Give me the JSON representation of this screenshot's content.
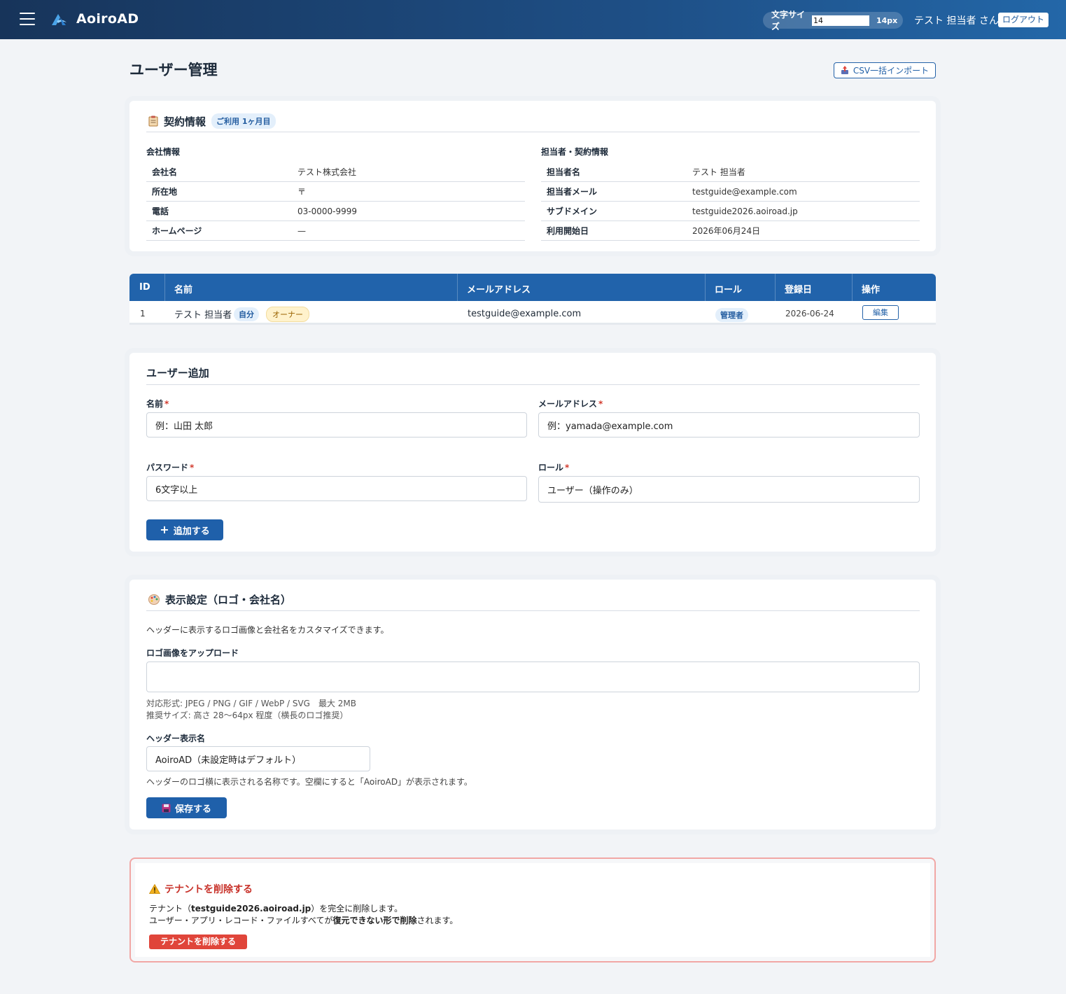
{
  "header": {
    "brand": "AoiroAD",
    "font_size_label": "文字サイズ",
    "font_size_input": "14",
    "font_size_value": "14px",
    "user_name": "テスト 担当者 さん",
    "logout_label": "ログアウト"
  },
  "page": {
    "title": "ユーザー管理",
    "csv_import_label": "CSV一括インポート"
  },
  "contract": {
    "title": "契約情報",
    "usage_badge": "ご利用 1ヶ月目",
    "company_heading": "会社情報",
    "company_rows": [
      {
        "key": "会社名",
        "value": "テスト株式会社"
      },
      {
        "key": "所在地",
        "value": "〒"
      },
      {
        "key": "電話",
        "value": "03-0000-9999"
      },
      {
        "key": "ホームページ",
        "value": "—"
      }
    ],
    "manager_heading": "担当者・契約情報",
    "manager_rows": [
      {
        "key": "担当者名",
        "value": "テスト 担当者"
      },
      {
        "key": "担当者メール",
        "value": "testguide@example.com"
      },
      {
        "key": "サブドメイン",
        "value": "testguide2026.aoiroad.jp"
      },
      {
        "key": "利用開始日",
        "value": "2026年06月24日"
      }
    ]
  },
  "users_table": {
    "columns": [
      "ID",
      "名前",
      "メールアドレス",
      "ロール",
      "登録日",
      "操作"
    ],
    "rows": [
      {
        "id": "1",
        "name": "テスト 担当者",
        "self_badge": "自分",
        "owner_badge": "オーナー",
        "email": "testguide@example.com",
        "role": "管理者",
        "registered": "2026-06-24",
        "action": "編集"
      }
    ]
  },
  "add_user": {
    "title": "ユーザー追加",
    "name_label": "名前",
    "name_placeholder": "例：山田 太郎",
    "email_label": "メールアドレス",
    "email_placeholder": "例：yamada@example.com",
    "password_label": "パスワード",
    "password_placeholder": "6文字以上",
    "role_label": "ロール",
    "role_value": "ユーザー（操作のみ）",
    "required_mark": "*",
    "submit_label": "追加する"
  },
  "display_settings": {
    "title": "表示設定（ロゴ・会社名）",
    "description": "ヘッダーに表示するロゴ画像と会社名をカスタマイズできます。",
    "logo_label": "ロゴ画像をアップロード",
    "formats_note": "対応形式: JPEG / PNG / GIF / WebP / SVG　最大 2MB",
    "size_note": "推奨サイズ: 高さ 28〜64px 程度（横長のロゴ推奨）",
    "header_name_label": "ヘッダー表示名",
    "header_name_placeholder": "AoiroAD（未設定時はデフォルト）",
    "header_name_note": "ヘッダーのロゴ横に表示される名称です。空欄にすると「AoiroAD」が表示されます。",
    "save_label": "保存する"
  },
  "danger": {
    "title": "テナントを削除する",
    "line1_prefix": "テナント（",
    "line1_domain": "testguide2026.aoiroad.jp",
    "line1_suffix": "）を完全に削除します。",
    "line2_prefix": "ユーザー・アプリ・レコード・ファイルすべてが",
    "line2_bold": "復元できない形で削除",
    "line2_suffix": "されます。",
    "button_label": "テナントを削除する"
  },
  "colors": {
    "header_start": "#17345a",
    "header_end": "#2367a8",
    "primary": "#1f60aa",
    "danger": "#e0453a",
    "danger_text": "#c8322a"
  }
}
